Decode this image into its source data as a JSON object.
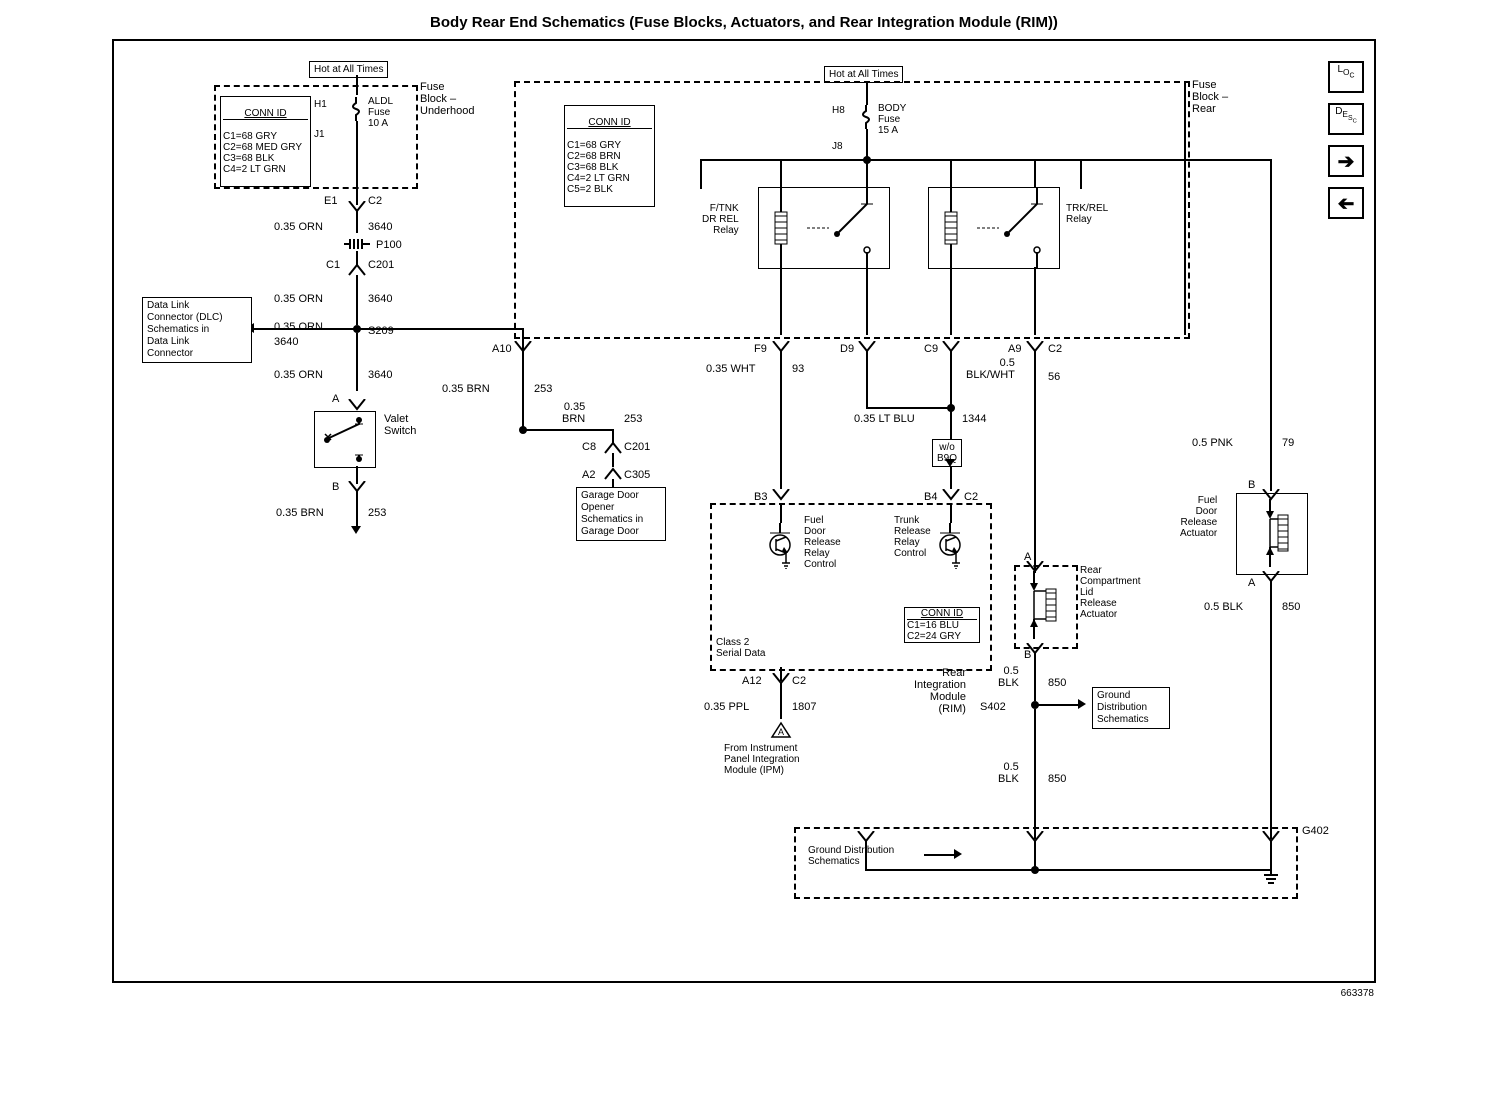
{
  "title": "Body Rear End Schematics (Fuse Blocks, Actuators, and Rear Integration Module (RIM))",
  "page_number": "663378",
  "hot_at_all_times": "Hot at All Times",
  "fuse_underhood": {
    "label": "Fuse\nBlock –\nUnderhood",
    "fuse_name": "ALDL\nFuse\n10 A",
    "h1": "H1",
    "j1": "J1",
    "conn_id_label": "CONN ID",
    "conn_id": "C1=68 GRY\nC2=68 MED GRY\nC3=68 BLK\nC4=2 LT GRN"
  },
  "fuse_rear": {
    "label": "Fuse\nBlock –\nRear",
    "body_fuse": "BODY\nFuse\n15 A",
    "h8": "H8",
    "j8": "J8",
    "relay1": "F/TNK\nDR REL\nRelay",
    "relay2": "TRK/REL\nRelay",
    "conn_id_label": "CONN ID",
    "conn_id": "C1=68 GRY\nC2=68 BRN\nC3=68 BLK\nC4=2 LT GRN\nC5=2 BLK"
  },
  "wires": {
    "e1c2": "E1",
    "c2a": "C2",
    "orn1": "0.35 ORN",
    "c3640": "3640",
    "p100": "P100",
    "c1": "C1",
    "c201": "C201",
    "s209": "S209",
    "dlc_box": "Data Link\nConnector (DLC)\nSchematics in\nData Link\nConnector",
    "brn1": "0.35 BRN",
    "c253": "253",
    "a_label": "A",
    "b_label": "B",
    "valet": "Valet\nSwitch",
    "c8": "C8",
    "a2": "A2",
    "c305": "C305",
    "a10": "A10",
    "garage": "Garage Door\nOpener\nSchematics in\nGarage Door",
    "f9": "F9",
    "wht": "0.35 WHT",
    "c93": "93",
    "d9": "D9",
    "c9": "C9",
    "a9": "A9",
    "blkwht": "0.5\nBLK/WHT",
    "c56": "56",
    "ltblu": "0.35 LT BLU",
    "c1344": "1344",
    "wo_b9q": "w/o\nB9Q",
    "b3": "B3",
    "b4": "B4",
    "rim_box": {
      "fuel_relay": "Fuel\nDoor\nRelease\nRelay\nControl",
      "trunk_relay": "Trunk\nRelease\nRelay\nControl",
      "class2": "Class 2\nSerial Data",
      "conn_id_label": "CONN ID",
      "conn_id": "C1=16 BLU\nC2=24 GRY",
      "label": "Rear\nIntegration\nModule\n(RIM)"
    },
    "trunk_lid": "Rear\nCompartment\nLid\nRelease\nActuator",
    "a12": "A12",
    "ppl": "0.35 PPL",
    "c1807": "1807",
    "from_ipm": "From Instrument\nPanel Integration\nModule (IPM)",
    "s402": "S402",
    "blk05": "0.5\nBLK",
    "c850": "850",
    "gnd_dist": "Ground\nDistribution\nSchematics",
    "g402": "G402",
    "gnd_dist2": "Ground Distribution\nSchematics",
    "pnk": "0.5 PNK",
    "c79": "79",
    "fuel_door_act": "Fuel\nDoor\nRelease\nActuator",
    "a_only": "A",
    "b_only": "B"
  },
  "nav": {
    "loc": "L O C",
    "desc": "D E S C",
    "next": "→",
    "prev": "←"
  }
}
